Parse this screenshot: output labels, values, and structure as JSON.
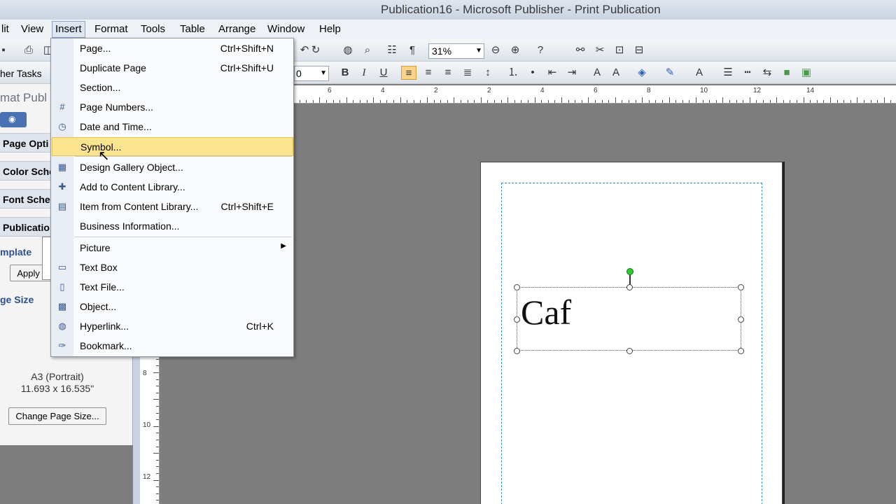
{
  "window": {
    "title": "Publication16 - Microsoft Publisher - Print Publication"
  },
  "menubar": {
    "items": [
      {
        "key": "edit",
        "label": "lit"
      },
      {
        "key": "view",
        "label": "View"
      },
      {
        "key": "insert",
        "label": "Insert"
      },
      {
        "key": "format",
        "label": "Format"
      },
      {
        "key": "tools",
        "label": "Tools"
      },
      {
        "key": "table",
        "label": "Table"
      },
      {
        "key": "arrange",
        "label": "Arrange"
      },
      {
        "key": "window",
        "label": "Window"
      },
      {
        "key": "help",
        "label": "Help"
      }
    ]
  },
  "toolbar": {
    "zoom": "31%",
    "font_size": "0"
  },
  "insert_menu": {
    "items": [
      {
        "label": "Page...",
        "shortcut": "Ctrl+Shift+N",
        "icon": ""
      },
      {
        "label": "Duplicate Page",
        "shortcut": "Ctrl+Shift+U",
        "icon": ""
      },
      {
        "label": "Section...",
        "shortcut": "",
        "icon": ""
      },
      {
        "label": "Page Numbers...",
        "shortcut": "",
        "icon": "page-numbers-icon"
      },
      {
        "label": "Date and Time...",
        "shortcut": "",
        "icon": "date-time-icon"
      },
      {
        "label": "Symbol...",
        "shortcut": "",
        "icon": ""
      },
      {
        "label": "Design Gallery Object...",
        "shortcut": "",
        "icon": "design-gallery-icon"
      },
      {
        "label": "Add to Content Library...",
        "shortcut": "",
        "icon": "add-content-library-icon"
      },
      {
        "label": "Item from Content Library...",
        "shortcut": "Ctrl+Shift+E",
        "icon": "content-library-icon"
      },
      {
        "label": "Business Information...",
        "shortcut": "",
        "icon": ""
      },
      {
        "label": "Picture",
        "shortcut": "",
        "icon": ""
      },
      {
        "label": "Text Box",
        "shortcut": "",
        "icon": "text-box-icon"
      },
      {
        "label": "Text File...",
        "shortcut": "",
        "icon": "text-file-icon"
      },
      {
        "label": "Object...",
        "shortcut": "",
        "icon": "object-icon"
      },
      {
        "label": "Hyperlink...",
        "shortcut": "Ctrl+K",
        "icon": "hyperlink-icon"
      },
      {
        "label": "Bookmark...",
        "shortcut": "",
        "icon": "bookmark-icon"
      }
    ],
    "highlighted": "Symbol..."
  },
  "task_pane": {
    "toolbar_label": "her Tasks",
    "header": "mat Publ",
    "links": [
      "Page Opti",
      "Color Sche",
      "Font Sche",
      "Publicatio"
    ],
    "template_heading": "mplate",
    "apply_button": "Apply a",
    "page_size_heading": "ge Size",
    "page_size_name": "A3 (Portrait)",
    "page_size_dims": "11.693 x 16.535\"",
    "change_page_size_button": "Change Page Size..."
  },
  "document": {
    "text": "Caf"
  },
  "rulers": {
    "h_labels": [
      "6",
      "4",
      "2",
      "2",
      "4",
      "6",
      "8",
      "10",
      "12",
      "14"
    ],
    "v_labels": [
      "8",
      "10",
      "12"
    ]
  }
}
